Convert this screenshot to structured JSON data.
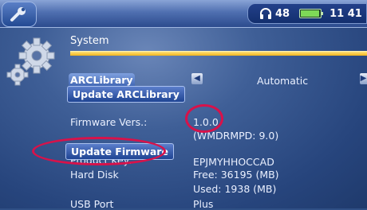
{
  "status": {
    "volume": "48",
    "time": "11 41",
    "battery_level": 0.95
  },
  "title": "System",
  "arclibrary": {
    "label": "ARCLibrary",
    "value": "Automatic",
    "update_button": "Update ARCLibrary"
  },
  "firmware": {
    "label": "Firmware Vers.:",
    "version": "1.0.0",
    "detail": "(WMDRMPD: 9.0)",
    "update_button": "Update Firmware"
  },
  "product_key": {
    "label": "Product Key:",
    "value": "EPJMYHHOCCAD"
  },
  "hard_disk": {
    "label": "Hard Disk",
    "free": "Free: 36195 (MB)",
    "used": "Used:  1938 (MB)"
  },
  "usb_port": {
    "label": "USB Port",
    "value": "Plus"
  },
  "icons": [
    "wrench-icon",
    "headphones-icon",
    "battery-icon",
    "gear-icon",
    "arrow-left-icon",
    "arrow-right-icon"
  ],
  "colors": {
    "accent_bar": "#f1b51c",
    "highlight_ring": "#d8124a",
    "background": "#2f4f85"
  }
}
